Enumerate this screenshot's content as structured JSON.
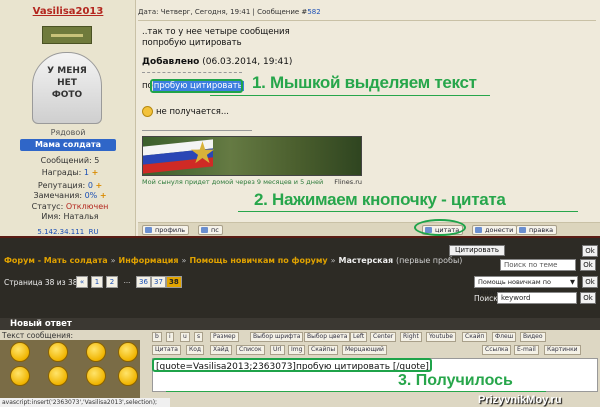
{
  "author": {
    "name": "Vasilisa2013",
    "avatar_text": "У МЕНЯ\nНЕТ\nФОТО",
    "status": "Рядовой",
    "group": "Мама солдата",
    "messages_label": "Сообщений:",
    "messages": "5",
    "awards_label": "Награды:",
    "awards": "1",
    "reputation_label": "Репутация:",
    "reputation": "0",
    "warnings_label": "Замечания:",
    "warnings": "0%",
    "online_label": "Статус:",
    "online": "Отключен",
    "name_label": "Имя:",
    "real_name": "Наталья",
    "ip": "5.142.34.111",
    "ip_country": "RU",
    "plus": "+"
  },
  "post": {
    "header_prefix": "Дата: Четверг, Сегодня, 19:41 | Сообщение #",
    "number": "582",
    "line1": "..так то у нее четыре сообщения",
    "line2": "попробую цитировать",
    "added_label": "Добавлено",
    "added_date": "(06.03.2014, 19:41)",
    "quote_prefix": "по",
    "quote_selected": "пробую цитировать",
    "not_working": "не получается...",
    "banner_caption": "Мой сынуля придет домой через 9 месяцев и 5 дней",
    "banner_site": "Flines.ru"
  },
  "post_buttons": {
    "profile": "профиль",
    "pm": "пс",
    "quote": "цитата",
    "report": "донести",
    "edit": "правка"
  },
  "annotations": {
    "step1": "1. Мышкой выделяем текст",
    "step2": "2. Нажимаем кнопочку - цитата",
    "step3": "3. Получилось"
  },
  "nav": {
    "crumbs": [
      "Форум - Мать солдата",
      "Информация",
      "Помощь новичкам по форуму"
    ],
    "current": "Мастерская",
    "current_sub": "(первые пробы)",
    "cite_button": "Цитировать",
    "search_topic_placeholder": "Поиск по теме",
    "ok": "Ok",
    "page_label": "Страница 38 из 38",
    "pages": [
      "«",
      "1",
      "2",
      "...",
      "36",
      "37",
      "38"
    ],
    "forum_select": "Помощь новичкам по форуму",
    "search_label": "Поиск:",
    "search_value": "keyword"
  },
  "reply": {
    "title": "Новый ответ",
    "text_label": "Текст сообщения:",
    "status_url": "avascript:insert('2363073','Vasilisa2013',selection);",
    "toolbar1": [
      "b",
      "i",
      "u",
      "s",
      "Размер",
      "Выбор шрифта",
      "Выбор цвета",
      "Left",
      "Center",
      "Right",
      "Youtube",
      "Скайп",
      "Флеш",
      "Видео"
    ],
    "toolbar2": [
      "Цитата",
      "Код",
      "Хайд",
      "Список",
      "Url",
      "Img",
      "Скайпы",
      "Мерцающий",
      "Ссылка",
      "E-mail",
      "Картинки"
    ],
    "bbcode": "[quote=Vasilisa2013;2363073]пробую цитировать [/quote]"
  },
  "watermark": "PrizyvnikMoy.ru"
}
